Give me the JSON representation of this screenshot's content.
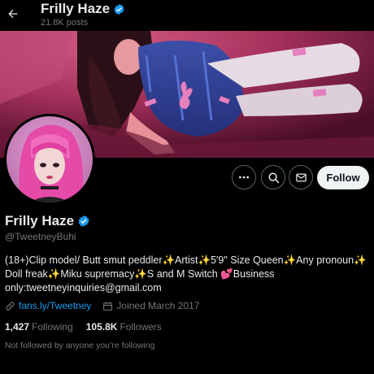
{
  "header": {
    "name": "Frilly Haze",
    "posts": "21.8K posts",
    "back_icon": "arrow-left-icon"
  },
  "colors": {
    "verified": "#1d9bf0",
    "link": "#1d9bf0",
    "follow_bg": "#eff3f4",
    "muted": "#71767b"
  },
  "actions": {
    "more_icon": "more-icon",
    "search_icon": "search-icon",
    "message_icon": "envelope-icon",
    "follow_label": "Follow"
  },
  "profile": {
    "name": "Frilly Haze",
    "handle": "@TweetneyBuhi",
    "bio": [
      "(18+)Clip model/ Butt smut peddler✨Artist✨5'9\" Size Queen✨Any pronoun✨",
      "Doll freak✨Miku supremacy✨S and M Switch 💕Business",
      "only:tweetneyinquiries@gmail.com"
    ],
    "link": "fans.ly/Tweetney",
    "joined": "Joined March 2017",
    "following_count": "1,427",
    "following_label": "Following",
    "followers_count": "105.8K",
    "followers_label": "Followers",
    "followed_by_note": "Not followed by anyone you’re following"
  }
}
